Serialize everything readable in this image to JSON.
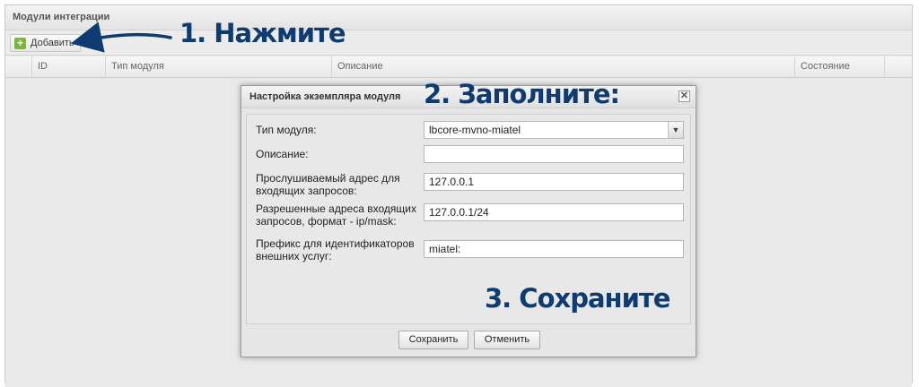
{
  "panel": {
    "title": "Модули интеграции"
  },
  "toolbar": {
    "add_label": "Добавить",
    "add_icon": "plus-icon"
  },
  "grid": {
    "columns": [
      "",
      "ID",
      "Тип модуля",
      "Описание",
      "Состояние",
      ""
    ]
  },
  "annotations": {
    "step1": "1. Нажмите",
    "step2": "2. Заполните:",
    "step3": "3. Сохраните",
    "color": "#0f3c70"
  },
  "dialog": {
    "title": "Настройка экземпляра модуля",
    "close_icon": "close-icon",
    "fields": [
      {
        "label": "Тип модуля:",
        "value": "lbcore-mvno-miatel",
        "type": "select"
      },
      {
        "label": "Описание:",
        "value": "",
        "type": "text"
      },
      {
        "label": "Прослушиваемый адрес для входящих запросов:",
        "value": "127.0.0.1",
        "type": "text"
      },
      {
        "label": "Разрешенные адреса входящих запросов, формат - ip/mask:",
        "value": "127.0.0.1/24",
        "type": "text"
      },
      {
        "label": "Префикс для идентификаторов внешних услуг:",
        "value": "miatel:",
        "type": "text"
      }
    ],
    "save_label": "Сохранить",
    "cancel_label": "Отменить"
  }
}
